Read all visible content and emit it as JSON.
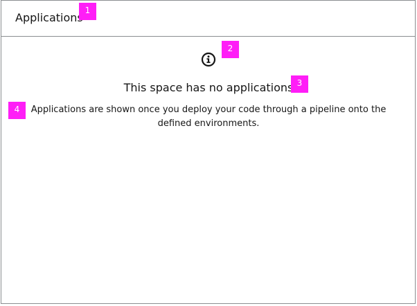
{
  "card": {
    "title": "Applications"
  },
  "empty_state": {
    "icon": "info-circle-icon",
    "title": "This space has no applications",
    "body": "Applications are shown once you deploy your code through a pipeline onto the defined environments."
  },
  "annotations": {
    "marker_1": "1",
    "marker_2": "2",
    "marker_3": "3",
    "marker_4": "4",
    "marker_color": "#ff1ef7"
  }
}
